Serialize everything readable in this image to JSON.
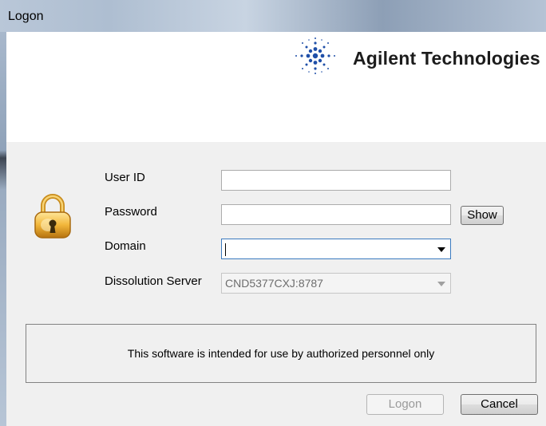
{
  "window": {
    "title": "Logon"
  },
  "brand": {
    "logo_text": "Agilent Technologies",
    "logo_color": "#1f4fa8"
  },
  "form": {
    "user_id": {
      "label": "User ID",
      "value": ""
    },
    "password": {
      "label": "Password",
      "value": "",
      "show_label": "Show"
    },
    "domain": {
      "label": "Domain",
      "value": ""
    },
    "server": {
      "label": "Dissolution Server",
      "value": "CND5377CXJ:8787"
    }
  },
  "notice": "This software is intended for use by authorized personnel only",
  "buttons": {
    "logon": "Logon",
    "cancel": "Cancel"
  },
  "icons": {
    "security": "padlock-key-icon",
    "dropdown": "chevron-down-icon"
  }
}
